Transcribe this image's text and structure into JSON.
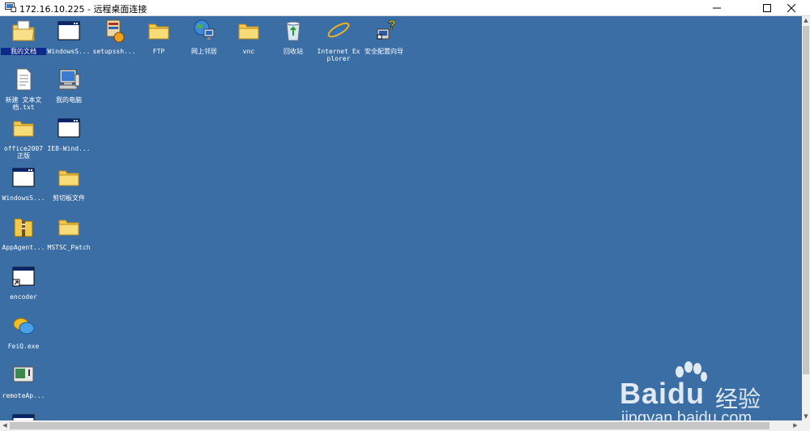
{
  "window": {
    "title": "172.16.10.225 - 远程桌面连接",
    "minimize": "minimize",
    "maximize": "maximize",
    "close": "close"
  },
  "desktop": {
    "background": "#3a6ea5",
    "icons": [
      {
        "label": "我的文档",
        "icon": "my-documents-icon"
      },
      {
        "label": "WindowsS...",
        "icon": "window-app-icon"
      },
      {
        "label": "setupssh...",
        "icon": "installer-icon"
      },
      {
        "label": "FTP",
        "icon": "folder-icon"
      },
      {
        "label": "网上邻居",
        "icon": "network-icon"
      },
      {
        "label": "vnc",
        "icon": "folder-icon"
      },
      {
        "label": "回收站",
        "icon": "recycle-bin-icon"
      },
      {
        "label": "Internet Explorer",
        "icon": "internet-explorer-icon"
      },
      {
        "label": "安全配置向导",
        "icon": "security-wizard-icon"
      },
      {
        "label": "新建 文本文档.txt",
        "icon": "text-file-icon"
      },
      {
        "label": "我的电脑",
        "icon": "my-computer-icon"
      },
      {
        "label": "office2007正版",
        "icon": "folder-icon"
      },
      {
        "label": "IE8-Wind...",
        "icon": "window-app-icon"
      },
      {
        "label": "WindowsS...",
        "icon": "window-app-icon"
      },
      {
        "label": "剪切板文件",
        "icon": "folder-icon"
      },
      {
        "label": "AppAgent...",
        "icon": "archive-folder-icon"
      },
      {
        "label": "MSTSC_Patch",
        "icon": "folder-icon"
      },
      {
        "label": "encoder",
        "icon": "shortcut-app-icon"
      },
      {
        "label": "FeiQ.exe",
        "icon": "feiq-icon"
      },
      {
        "label": "remoteAp...",
        "icon": "remote-app-icon"
      },
      {
        "label": "",
        "icon": "window-app-icon"
      }
    ]
  },
  "watermark": {
    "brand": "Bai",
    "brand_suffix": "du",
    "cn": "经验",
    "url": "jingyan.baidu.com"
  }
}
